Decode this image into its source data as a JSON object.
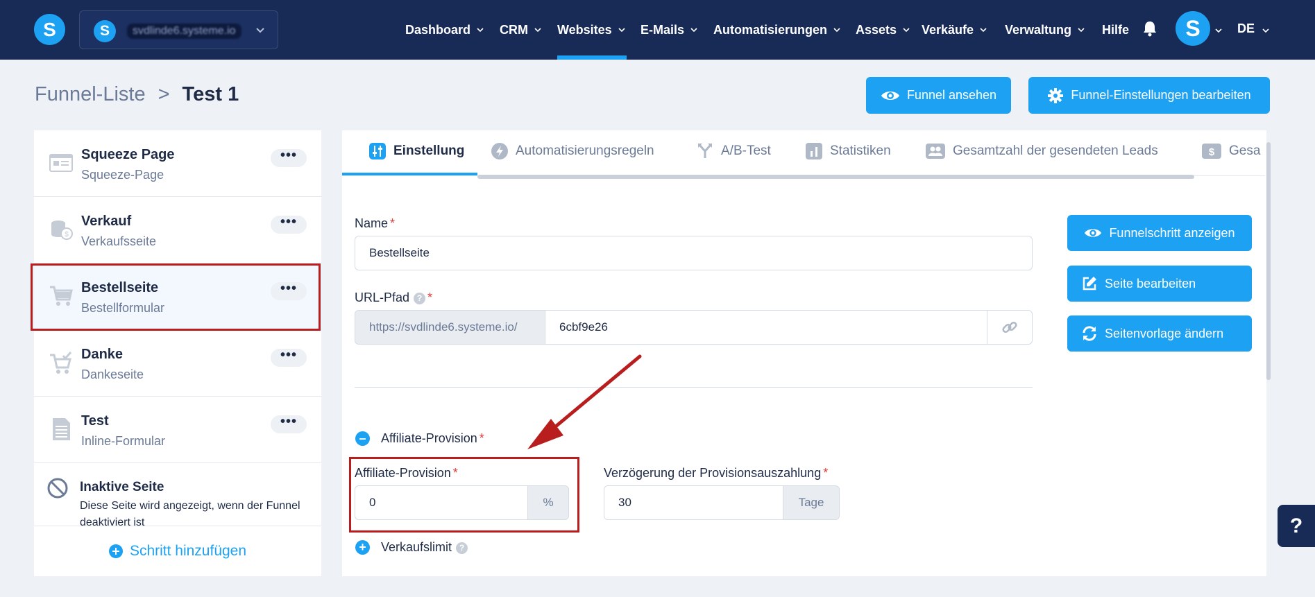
{
  "topbar": {
    "logo_letter": "S",
    "site": {
      "letter": "S",
      "name": "svdlinde6.systeme.io"
    },
    "nav": [
      "Dashboard",
      "CRM",
      "Websites",
      "E-Mails",
      "Automatisierungen",
      "Assets",
      "Verkäufe",
      "Verwaltung",
      "Hilfe"
    ],
    "active_nav": "Websites",
    "avatar_letter": "S",
    "lang": "DE"
  },
  "breadcrumb": {
    "root": "Funnel-Liste",
    "sep": ">",
    "current": "Test 1"
  },
  "header_buttons": {
    "view_funnel": "Funnel ansehen",
    "edit_settings": "Funnel-Einstellungen bearbeiten"
  },
  "steps": [
    {
      "title": "Squeeze Page",
      "sub": "Squeeze-Page",
      "icon": "page-icon"
    },
    {
      "title": "Verkauf",
      "sub": "Verkaufsseite",
      "icon": "coins-icon"
    },
    {
      "title": "Bestellseite",
      "sub": "Bestellformular",
      "icon": "cart-icon",
      "selected": true
    },
    {
      "title": "Danke",
      "sub": "Dankeseite",
      "icon": "cart-check-icon"
    },
    {
      "title": "Test",
      "sub": "Inline-Formular",
      "icon": "document-icon"
    }
  ],
  "more_label": "•••",
  "inactive": {
    "title": "Inaktive Seite",
    "desc": "Diese Seite wird angezeigt, wenn der Funnel deaktiviert ist"
  },
  "add_step": "Schritt hinzufügen",
  "tabs": [
    "Einstellung",
    "Automatisierungsregeln",
    "A/B-Test",
    "Statistiken",
    "Gesamtzahl der gesendeten Leads",
    "Gesa"
  ],
  "form": {
    "name_label": "Name",
    "name_value": "Bestellseite",
    "url_label": "URL-Pfad",
    "url_prefix": "https://svdlinde6.systeme.io/",
    "url_value": "6cbf9e26",
    "affiliate_section": "Affiliate-Provision",
    "affiliate_label": "Affiliate-Provision",
    "affiliate_value": "0",
    "affiliate_unit": "%",
    "delay_label": "Verzögerung der Provisionsauszahlung",
    "delay_value": "30",
    "delay_unit": "Tage",
    "sales_limit": "Verkaufslimit"
  },
  "side_buttons": {
    "view_step": "Funnelschritt anzeigen",
    "edit_page": "Seite bearbeiten",
    "change_template": "Seitenvorlage ändern"
  },
  "help_label": "?",
  "colors": {
    "navy": "#182b57",
    "accent": "#1da1f2",
    "annotation": "#b81e1e"
  }
}
